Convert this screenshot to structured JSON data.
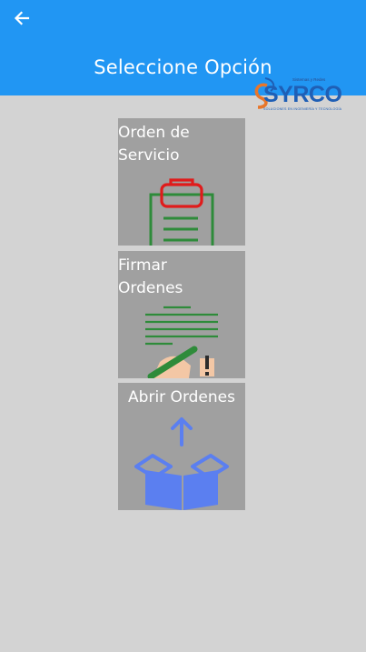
{
  "header": {
    "title": "Seleccione Opción",
    "background_color": "#2196f3",
    "back_icon": "arrow-left-icon"
  },
  "logo": {
    "brand": "SYRCO",
    "tagline": "Sistemas y Redes",
    "subtitle": "SOLUCIONES EN INGENIERÍA Y TECNOLOGÍA"
  },
  "options": [
    {
      "label_line1": "Orden de",
      "label_line2": "Servicio",
      "icon": "clipboard-icon"
    },
    {
      "label_line1": "Firmar",
      "label_line2": "Ordenes",
      "icon": "sign-document-icon"
    },
    {
      "label": "Abrir Ordenes",
      "icon": "open-box-icon"
    }
  ],
  "colors": {
    "tile_background": "#a0a0a0",
    "page_background": "#d3d3d3",
    "icon_green": "#2e8b3a",
    "icon_red": "#e01b1b",
    "icon_blue": "#5b7ff0"
  }
}
